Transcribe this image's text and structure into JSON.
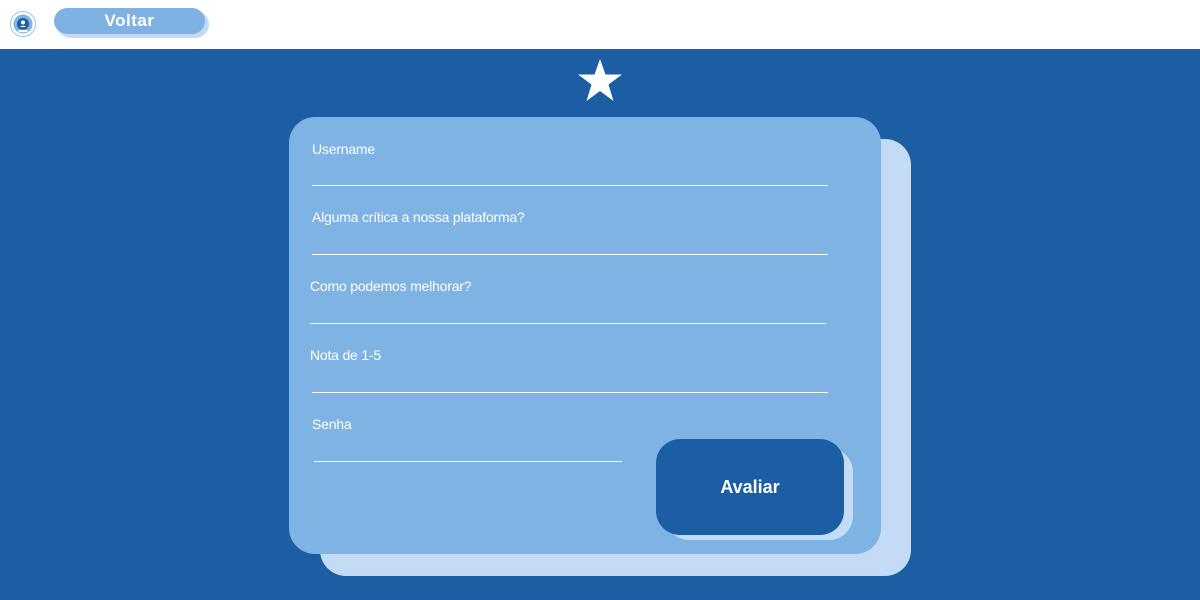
{
  "header": {
    "logo_icon": "globe-logo-icon",
    "back_label": "Voltar"
  },
  "main": {
    "rating_icon": "star-icon",
    "form": {
      "fields": [
        {
          "label": "Username",
          "value": ""
        },
        {
          "label": "Alguma crítica a nossa plataforma?",
          "value": ""
        },
        {
          "label": "Como podemos melhorar?",
          "value": ""
        },
        {
          "label": "Nota de 1-5",
          "value": ""
        },
        {
          "label": "Senha",
          "value": ""
        }
      ],
      "submit_label": "Avaliar"
    }
  },
  "colors": {
    "background": "#1b5ea3",
    "card": "#7fb3e4",
    "card_shadow": "#c3dbf4",
    "header": "#ffffff",
    "text": "#ffffff"
  }
}
